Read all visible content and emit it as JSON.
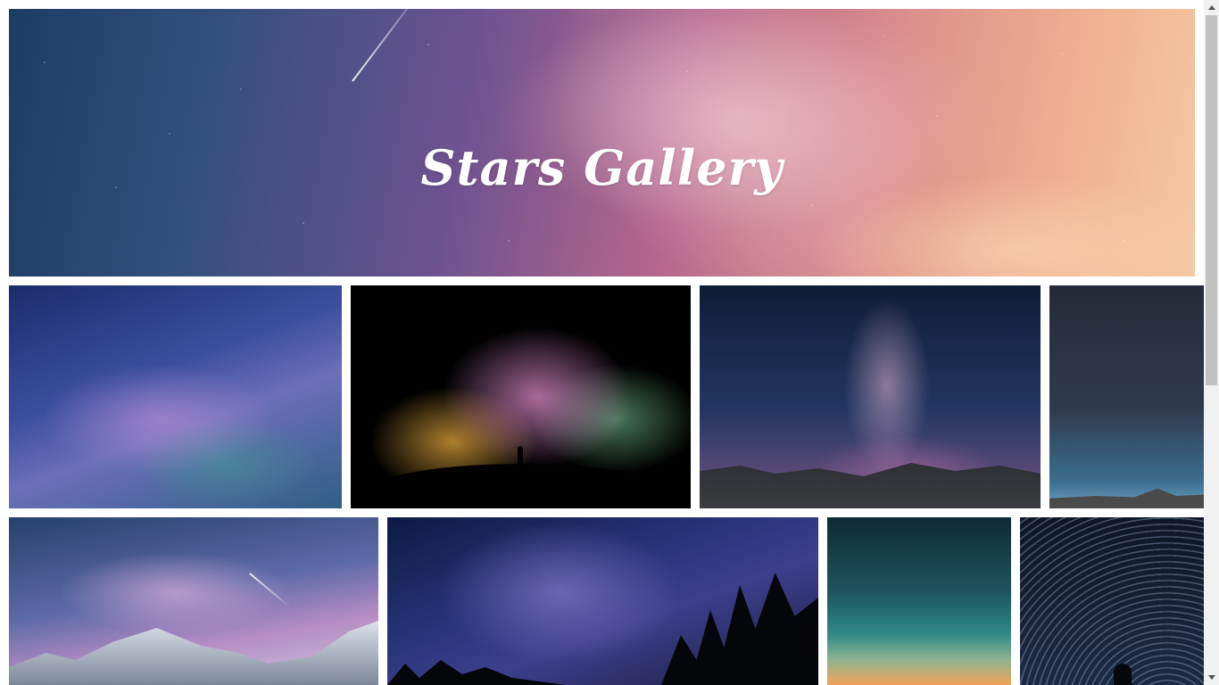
{
  "hero": {
    "title": "Stars Gallery"
  },
  "gallery": {
    "photos": [
      {
        "subject": "milky-way-blue"
      },
      {
        "subject": "person-under-milky-way"
      },
      {
        "subject": "milky-way-over-mountains"
      },
      {
        "subject": "night-sky-mountain-range"
      },
      {
        "subject": "snowy-mountains-milky-way"
      },
      {
        "subject": "milky-way-forest"
      },
      {
        "subject": "teal-sky-sunset"
      },
      {
        "subject": "star-trails"
      }
    ]
  },
  "colors": {
    "page_background": "#ffffff",
    "title_text": "#ffffff"
  },
  "icons": {
    "scroll_up": "arrow-up-icon",
    "scroll_down": "arrow-down-icon"
  }
}
